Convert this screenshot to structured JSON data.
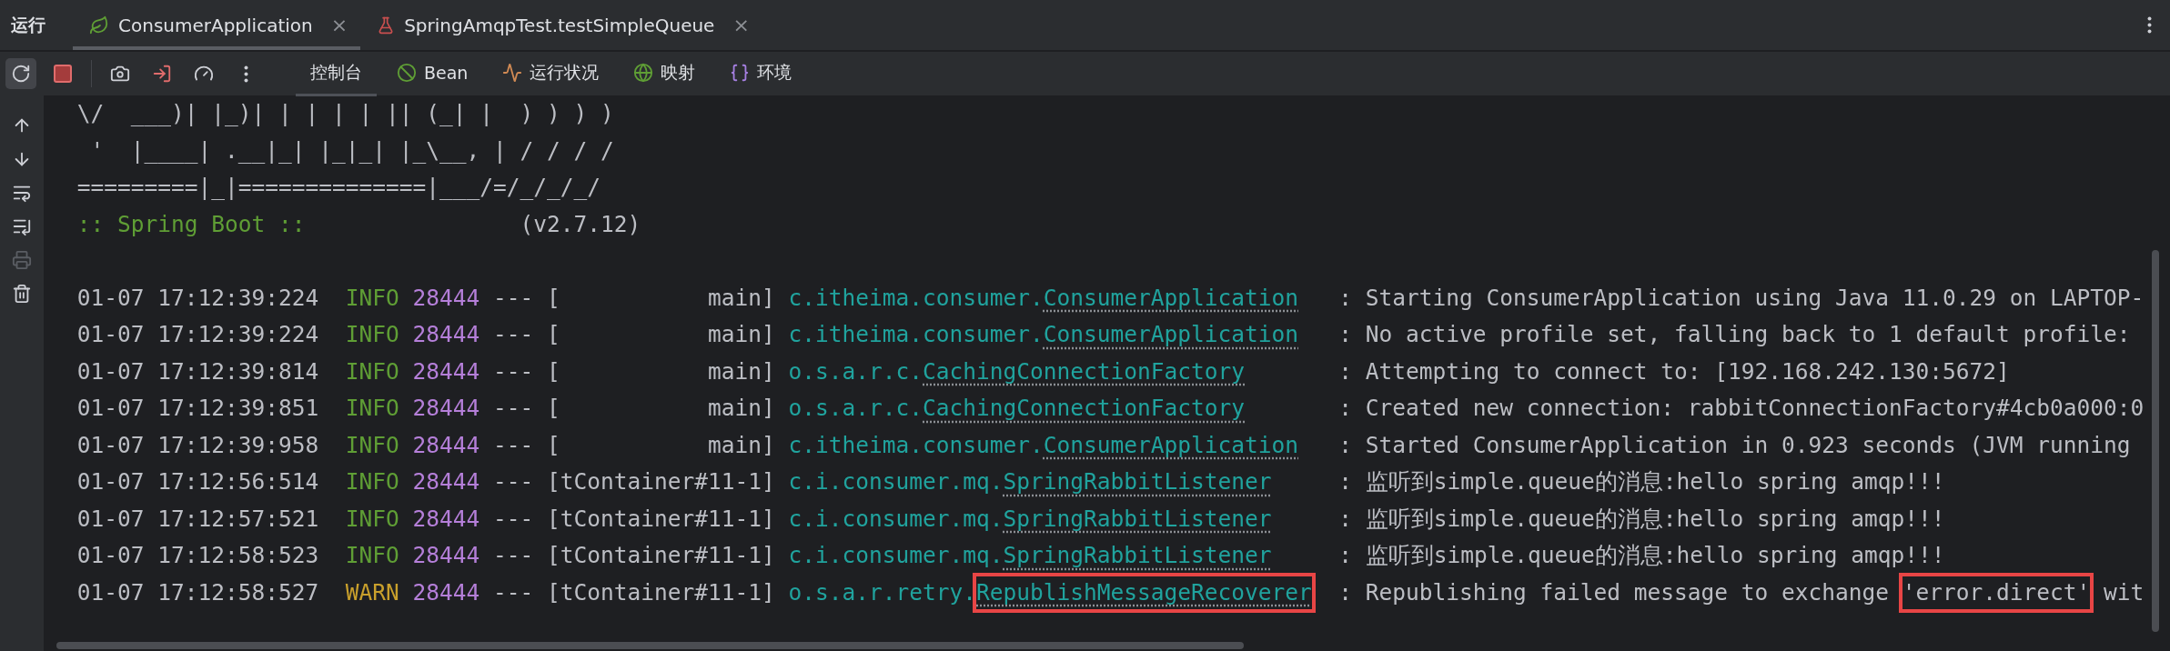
{
  "panel_title": "运行",
  "run_tabs": [
    {
      "label": "ConsumerApplication",
      "kind": "spring",
      "selected": true,
      "close": "×"
    },
    {
      "label": "SpringAmqpTest.testSimpleQueue",
      "kind": "test",
      "selected": false,
      "close": "×"
    }
  ],
  "view_tabs": [
    {
      "label": "控制台",
      "kind": "console",
      "selected": true
    },
    {
      "label": "Bean",
      "kind": "bean",
      "selected": false
    },
    {
      "label": "运行状况",
      "kind": "health",
      "selected": false
    },
    {
      "label": "映射",
      "kind": "mapping",
      "selected": false
    },
    {
      "label": "环境",
      "kind": "env",
      "selected": false
    }
  ],
  "banner": [
    " \\/  ___)| |_)| | | | | || (_| |  ) ) ) )",
    "  '  |____| .__|_| |_|_| |_\\__, | / / / /",
    " =========|_|==============|___/=/_/_/_/"
  ],
  "boot_label": " :: Spring Boot :: ",
  "boot_version": "(v2.7.12)",
  "log_lines": [
    {
      "time": "01-07 17:12:39:224",
      "level": "INFO",
      "pid": "28444",
      "sep": "---",
      "thread": "[           main]",
      "logger_package": "c.itheima.consumer.",
      "logger_class": "ConsumerApplication",
      "logger_highlighted": false,
      "message": [
        {
          "text": ": Starting ConsumerApplication using Java 11.0.29 on LAPTOP-",
          "highlighted": false
        }
      ]
    },
    {
      "time": "01-07 17:12:39:224",
      "level": "INFO",
      "pid": "28444",
      "sep": "---",
      "thread": "[           main]",
      "logger_package": "c.itheima.consumer.",
      "logger_class": "ConsumerApplication",
      "logger_highlighted": false,
      "message": [
        {
          "text": ": No active profile set, falling back to 1 default profile:",
          "highlighted": false
        }
      ]
    },
    {
      "time": "01-07 17:12:39:814",
      "level": "INFO",
      "pid": "28444",
      "sep": "---",
      "thread": "[           main]",
      "logger_package": "o.s.a.r.c.",
      "logger_class": "CachingConnectionFactory",
      "logger_highlighted": false,
      "message": [
        {
          "text": ": Attempting to connect to: [192.168.242.130:5672]",
          "highlighted": false
        }
      ]
    },
    {
      "time": "01-07 17:12:39:851",
      "level": "INFO",
      "pid": "28444",
      "sep": "---",
      "thread": "[           main]",
      "logger_package": "o.s.a.r.c.",
      "logger_class": "CachingConnectionFactory",
      "logger_highlighted": false,
      "message": [
        {
          "text": ": Created new connection: rabbitConnectionFactory#4cb0a000:0",
          "highlighted": false
        }
      ]
    },
    {
      "time": "01-07 17:12:39:958",
      "level": "INFO",
      "pid": "28444",
      "sep": "---",
      "thread": "[           main]",
      "logger_package": "c.itheima.consumer.",
      "logger_class": "ConsumerApplication",
      "logger_highlighted": false,
      "message": [
        {
          "text": ": Started ConsumerApplication in 0.923 seconds (JVM running",
          "highlighted": false
        }
      ]
    },
    {
      "time": "01-07 17:12:56:514",
      "level": "INFO",
      "pid": "28444",
      "sep": "---",
      "thread": "[tContainer#11-1]",
      "logger_package": "c.i.consumer.mq.",
      "logger_class": "SpringRabbitListener",
      "logger_highlighted": false,
      "message": [
        {
          "text": ": 监听到simple.queue的消息:hello spring amqp!!!",
          "highlighted": false
        }
      ]
    },
    {
      "time": "01-07 17:12:57:521",
      "level": "INFO",
      "pid": "28444",
      "sep": "---",
      "thread": "[tContainer#11-1]",
      "logger_package": "c.i.consumer.mq.",
      "logger_class": "SpringRabbitListener",
      "logger_highlighted": false,
      "message": [
        {
          "text": ": 监听到simple.queue的消息:hello spring amqp!!!",
          "highlighted": false
        }
      ]
    },
    {
      "time": "01-07 17:12:58:523",
      "level": "INFO",
      "pid": "28444",
      "sep": "---",
      "thread": "[tContainer#11-1]",
      "logger_package": "c.i.consumer.mq.",
      "logger_class": "SpringRabbitListener",
      "logger_highlighted": false,
      "message": [
        {
          "text": ": 监听到simple.queue的消息:hello spring amqp!!!",
          "highlighted": false
        }
      ]
    },
    {
      "time": "01-07 17:12:58:527",
      "level": "WARN",
      "pid": "28444",
      "sep": "---",
      "thread": "[tContainer#11-1]",
      "logger_package": "o.s.a.r.retry.",
      "logger_class": "RepublishMessageRecoverer",
      "logger_highlighted": true,
      "message": [
        {
          "text": ": Republishing failed message to exchange ",
          "highlighted": false
        },
        {
          "text": "'error.direct'",
          "highlighted": true
        },
        {
          "text": " wit",
          "highlighted": false
        }
      ]
    }
  ]
}
